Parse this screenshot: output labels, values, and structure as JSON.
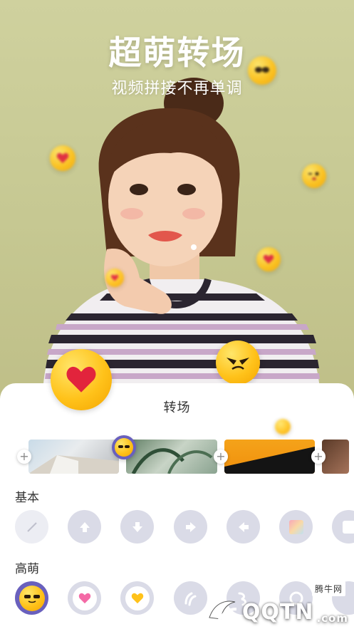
{
  "hero": {
    "title": "超萌转场",
    "subtitle": "视频拼接不再单调"
  },
  "sheet": {
    "title": "转场",
    "clip_add_symbol": "+",
    "sections": [
      {
        "label": "基本",
        "items": [
          "none",
          "up-arrow",
          "down-arrow",
          "right-arrow",
          "left-arrow",
          "gradient-square",
          "square"
        ]
      },
      {
        "label": "高萌",
        "items": [
          "cool-face",
          "pink-heart",
          "yellow-heart",
          "paw",
          "swirl",
          "ring",
          "more"
        ]
      }
    ]
  },
  "watermark": {
    "brand": "QQTN",
    "suffix": ".com",
    "tag": "腾牛网"
  },
  "colors": {
    "emoji_yellow": "#ffc21a",
    "heart_red": "#e2243c",
    "selected_ring": "#6960bd",
    "button_bg": "#dadbe7"
  }
}
